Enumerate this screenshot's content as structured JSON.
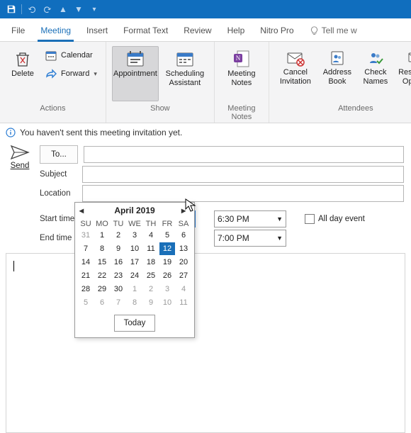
{
  "qat": {
    "save_icon": "save-icon"
  },
  "tabs": {
    "file": "File",
    "meeting": "Meeting",
    "insert": "Insert",
    "format_text": "Format Text",
    "review": "Review",
    "help": "Help",
    "nitro": "Nitro Pro",
    "tellme": "Tell me w"
  },
  "ribbon": {
    "actions": {
      "label": "Actions",
      "delete": "Delete",
      "calendar": "Calendar",
      "forward": "Forward"
    },
    "show": {
      "label": "Show",
      "appointment": "Appointment",
      "scheduling": "Scheduling\nAssistant"
    },
    "meeting_notes": {
      "label": "Meeting Notes",
      "btn": "Meeting\nNotes"
    },
    "attendees": {
      "label": "Attendees",
      "cancel": "Cancel\nInvitation",
      "address": "Address\nBook",
      "check": "Check\nNames",
      "response": "Response\nOptions"
    }
  },
  "info": "You haven't sent this meeting invitation yet.",
  "form": {
    "send": "Send",
    "to_btn": "To...",
    "subject_label": "Subject",
    "location_label": "Location",
    "start_label": "Start time",
    "end_label": "End time",
    "start_date": "Fri 12 Apr 2019",
    "start_time": "6:30 PM",
    "end_time": "7:00 PM",
    "all_day": "All day event",
    "subject_val": "",
    "to_val": "",
    "location_val": ""
  },
  "datepicker": {
    "month": "April 2019",
    "today": "Today",
    "dow": [
      "SU",
      "MO",
      "TU",
      "WE",
      "TH",
      "FR",
      "SA"
    ],
    "weeks": [
      {
        "days": [
          31,
          1,
          2,
          3,
          4,
          5,
          6
        ],
        "dim": [
          true,
          false,
          false,
          false,
          false,
          false,
          false
        ]
      },
      {
        "days": [
          7,
          8,
          9,
          10,
          11,
          12,
          13
        ],
        "dim": [
          false,
          false,
          false,
          false,
          false,
          false,
          false
        ],
        "sel": 5
      },
      {
        "days": [
          14,
          15,
          16,
          17,
          18,
          19,
          20
        ],
        "dim": [
          false,
          false,
          false,
          false,
          false,
          false,
          false
        ]
      },
      {
        "days": [
          21,
          22,
          23,
          24,
          25,
          26,
          27
        ],
        "dim": [
          false,
          false,
          false,
          false,
          false,
          false,
          false
        ]
      },
      {
        "days": [
          28,
          29,
          30,
          1,
          2,
          3,
          4
        ],
        "dim": [
          false,
          false,
          false,
          true,
          true,
          true,
          true
        ]
      },
      {
        "days": [
          5,
          6,
          7,
          8,
          9,
          10,
          11
        ],
        "dim": [
          true,
          true,
          true,
          true,
          true,
          true,
          true
        ]
      }
    ]
  }
}
